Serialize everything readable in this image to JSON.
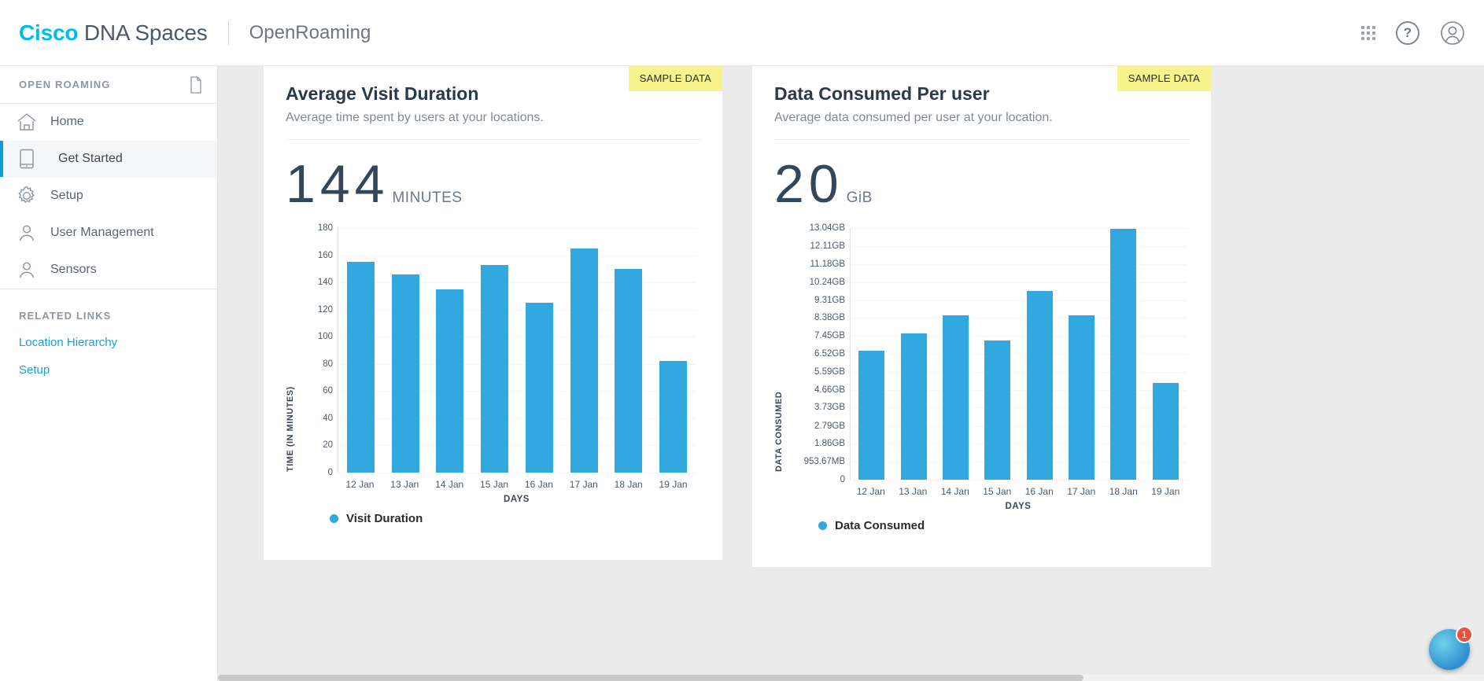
{
  "topbar": {
    "brand_cisco": "Cisco",
    "brand_rest": " DNA Spaces",
    "app_name": "OpenRoaming",
    "apps_icon": "grid-apps-icon",
    "help_label": "?",
    "account_icon": "user-account-icon"
  },
  "sidebar": {
    "title": "OPEN ROAMING",
    "doc_icon": "document-icon",
    "items": [
      {
        "label": "Home",
        "icon": "home-icon",
        "active": false
      },
      {
        "label": "Get Started",
        "icon": "device-icon",
        "active": true
      },
      {
        "label": "Setup",
        "icon": "gear-icon",
        "active": false
      },
      {
        "label": "User Management",
        "icon": "user-icon",
        "active": false
      },
      {
        "label": "Sensors",
        "icon": "user-icon",
        "active": false
      }
    ],
    "related_title": "RELATED LINKS",
    "related_links": [
      {
        "label": "Location Hierarchy"
      },
      {
        "label": "Setup"
      }
    ]
  },
  "cards": [
    {
      "badge": "SAMPLE DATA",
      "title": "Average Visit Duration",
      "subtitle": "Average time spent by users at your locations.",
      "kpi_value": "144",
      "kpi_unit": "MINUTES"
    },
    {
      "badge": "SAMPLE DATA",
      "title": "Data Consumed Per user",
      "subtitle": "Average data consumed per user at your location.",
      "kpi_value": "20",
      "kpi_unit": "GiB"
    }
  ],
  "fab": {
    "badge_count": "1",
    "icon": "chat-assistant-icon"
  },
  "colors": {
    "accent": "#00bceb",
    "bar": "#31a8e0",
    "badge_bg": "#f7f48b",
    "sidebar_active": "#0f9bd7",
    "text_dark": "#2b3a4a"
  },
  "chart_data": [
    {
      "type": "bar",
      "title": "Average Visit Duration",
      "categories": [
        "12 Jan",
        "13 Jan",
        "14 Jan",
        "15 Jan",
        "16 Jan",
        "17 Jan",
        "18 Jan",
        "19 Jan"
      ],
      "values": [
        155,
        146,
        135,
        153,
        125,
        165,
        150,
        82
      ],
      "series": [
        {
          "name": "Visit Duration",
          "values": [
            155,
            146,
            135,
            153,
            125,
            165,
            150,
            82
          ]
        }
      ],
      "xlabel": "DAYS",
      "ylabel": "TIME (IN MINUTES)",
      "yticks": [
        0,
        20,
        40,
        60,
        80,
        100,
        120,
        140,
        160,
        180
      ],
      "yticklabels": [
        "0",
        "20",
        "40",
        "60",
        "80",
        "100",
        "120",
        "140",
        "160",
        "180"
      ],
      "ylim": [
        0,
        180
      ],
      "legend": [
        "Visit Duration"
      ],
      "legend_position": "bottom-left",
      "grid": true
    },
    {
      "type": "bar",
      "title": "Data Consumed Per user",
      "categories": [
        "12 Jan",
        "13 Jan",
        "14 Jan",
        "15 Jan",
        "16 Jan",
        "17 Jan",
        "18 Jan",
        "19 Jan"
      ],
      "values": [
        6.7,
        7.6,
        8.5,
        7.2,
        9.8,
        8.5,
        13.0,
        5.0
      ],
      "series": [
        {
          "name": "Data Consumed",
          "values": [
            6.7,
            7.6,
            8.5,
            7.2,
            9.8,
            8.5,
            13.0,
            5.0
          ]
        }
      ],
      "xlabel": "DAYS",
      "ylabel": "DATA CONSUMED",
      "yticks": [
        0,
        0.931,
        1.86,
        2.79,
        3.73,
        4.66,
        5.59,
        6.52,
        7.45,
        8.38,
        9.31,
        10.24,
        11.18,
        12.11,
        13.04
      ],
      "yticklabels": [
        "0",
        "953.67MB",
        "1.86GB",
        "2.79GB",
        "3.73GB",
        "4.66GB",
        "5.59GB",
        "6.52GB",
        "7.45GB",
        "8.38GB",
        "9.31GB",
        "10.24GB",
        "11.18GB",
        "12.11GB",
        "13.04GB"
      ],
      "ylim": [
        0,
        13.04
      ],
      "legend": [
        "Data Consumed"
      ],
      "legend_position": "bottom-left",
      "grid": true,
      "unit": "GB"
    }
  ]
}
